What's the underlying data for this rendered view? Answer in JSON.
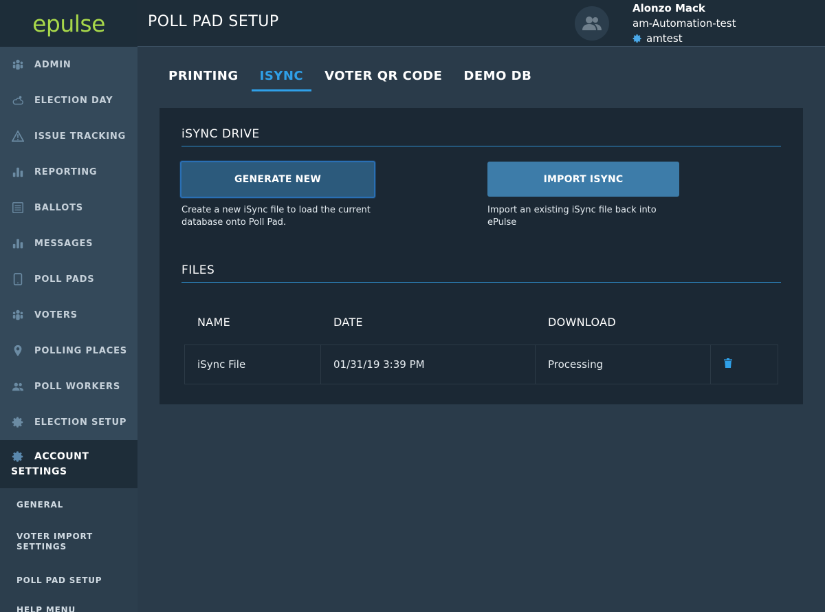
{
  "sidebar": {
    "logo": "epulse",
    "items": [
      {
        "label": "ADMIN",
        "icon": "people-icon"
      },
      {
        "label": "ELECTION DAY",
        "icon": "weather-icon"
      },
      {
        "label": "ISSUE TRACKING",
        "icon": "warning-icon"
      },
      {
        "label": "REPORTING",
        "icon": "bar-chart-icon"
      },
      {
        "label": "BALLOTS",
        "icon": "ballot-icon"
      },
      {
        "label": "MESSAGES",
        "icon": "bar-chart-icon"
      },
      {
        "label": "POLL PADS",
        "icon": "tablet-icon"
      },
      {
        "label": "VOTERS",
        "icon": "people-icon"
      },
      {
        "label": "POLLING PLACES",
        "icon": "map-pin-icon"
      },
      {
        "label": "POLL WORKERS",
        "icon": "users-icon"
      },
      {
        "label": "ELECTION SETUP",
        "icon": "gear-icon"
      }
    ],
    "active": {
      "line1": "ACCOUNT",
      "line2": "SETTINGS",
      "icon": "gear-icon"
    },
    "sub_items": [
      "GENERAL",
      "VOTER IMPORT SETTINGS",
      "POLL PAD SETUP",
      "HELP MENU"
    ]
  },
  "header": {
    "title": "POLL PAD SETUP",
    "user_name": "Alonzo Mack",
    "org": "am-Automation-test",
    "account": "amtest"
  },
  "tabs": [
    {
      "label": "PRINTING",
      "active": false
    },
    {
      "label": "ISYNC",
      "active": true
    },
    {
      "label": "VOTER QR CODE",
      "active": false
    },
    {
      "label": "DEMO DB",
      "active": false
    }
  ],
  "isync": {
    "section_title": "iSYNC DRIVE",
    "generate_label": "GENERATE NEW",
    "generate_desc": "Create a new iSync file to load the current database onto Poll Pad.",
    "import_label": "IMPORT ISYNC",
    "import_desc": "Import an existing iSync file back into ePulse"
  },
  "files": {
    "section_title": "FILES",
    "columns": [
      "NAME",
      "DATE",
      "DOWNLOAD"
    ],
    "rows": [
      {
        "name": "iSync File",
        "date": "01/31/19 3:39 PM",
        "download": "Processing"
      }
    ]
  },
  "colors": {
    "accent": "#2fa0e8",
    "logo": "#a8d84a",
    "sidebar": "#34495a"
  }
}
